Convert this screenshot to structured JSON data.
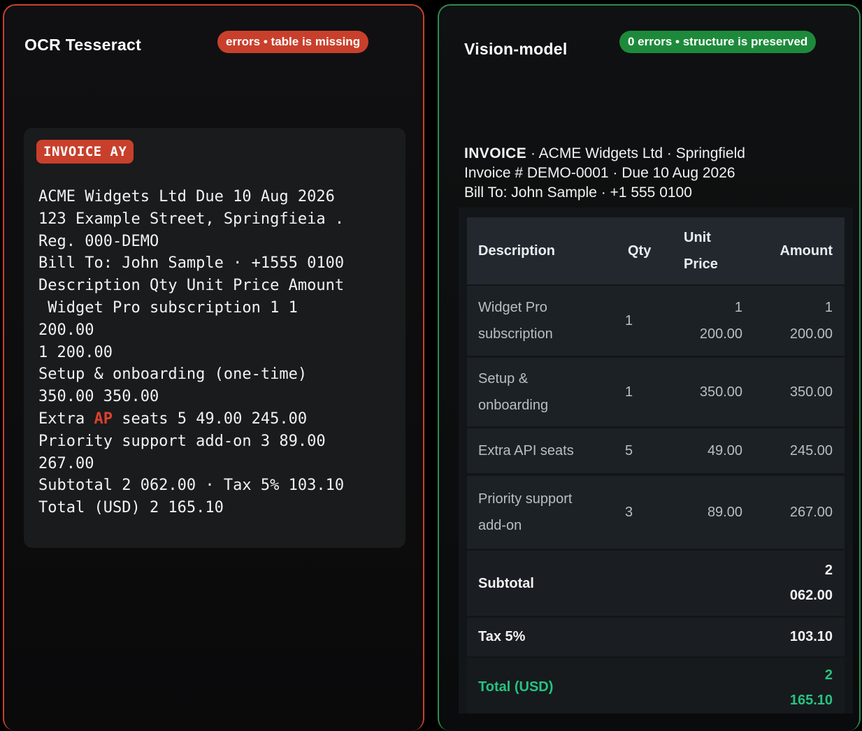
{
  "left": {
    "title": "OCR Tesseract",
    "badge": "errors • table is missing",
    "ocr_tag": "INVOICE AY",
    "ocr_lines": [
      "ACME Widgets Ltd Due 10 Aug 2026",
      "123 Example Street, Springfieia .",
      "Reg. 000-DEMO",
      "Bill To: John Sample · +1555 0100",
      "Description Qty Unit Price Amount",
      " Widget Pro subscription 1 1",
      "200.00",
      "1 200.00",
      "Setup & onboarding (one-time)",
      "350.00 350.00"
    ],
    "ocr_line_extra_pre": "Extra ",
    "ocr_line_extra_err": "AP",
    "ocr_line_extra_post": " seats 5 49.00 245.00",
    "ocr_lines_after": [
      "Priority support add-on 3 89.00",
      "267.00",
      "Subtotal 2 062.00 · Tax 5% 103.10",
      "Total (USD) 2 165.10"
    ]
  },
  "right": {
    "title": "Vision-model",
    "badge": "0 errors • structure is preserved",
    "header_bold": "INVOICE",
    "header_line1_rest": " · ACME Widgets Ltd · Springfield",
    "header_line2": "Invoice # DEMO-0001 · Due 10 Aug 2026",
    "header_line3": "Bill To: John Sample · +1 555 0100",
    "table": {
      "headers": {
        "description": "Description",
        "qty": "Qty",
        "unit_price_1": "Unit",
        "unit_price_2": "Price",
        "amount": "Amount"
      },
      "rows": [
        {
          "desc1": "Widget Pro",
          "desc2": "subscription",
          "qty": "1",
          "unit1": "1",
          "unit2": "200.00",
          "amt1": "1",
          "amt2": "200.00"
        },
        {
          "desc1": "Setup &",
          "desc2": "onboarding",
          "qty": "1",
          "unit": "350.00",
          "amt": "350.00"
        },
        {
          "desc": "Extra API seats",
          "qty": "5",
          "unit": "49.00",
          "amt": "245.00"
        },
        {
          "desc1": "Priority support",
          "desc2": "add-on",
          "qty": "3",
          "unit": "89.00",
          "amt": "267.00"
        }
      ],
      "subtotal_label": "Subtotal",
      "subtotal_1": "2",
      "subtotal_2": "062.00",
      "tax_label": "Tax 5%",
      "tax_value": "103.10",
      "total_label": "Total (USD)",
      "total_1": "2",
      "total_2": "165.10"
    }
  },
  "colors": {
    "error": "#c8402c",
    "success": "#1d8a3b",
    "total": "#27c281"
  }
}
